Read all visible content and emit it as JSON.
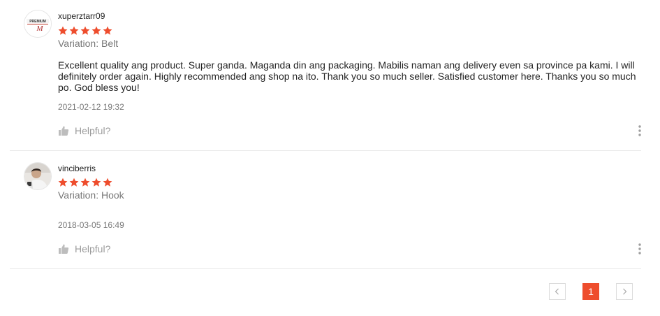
{
  "theme": {
    "accent": "#ee4d2d",
    "star_color": "#ee4d2d"
  },
  "reviews": [
    {
      "username": "xuperztarr09",
      "rating": 5,
      "variation": "Variation: Belt",
      "comment": "Excellent quality ang product. Super ganda. Maganda din ang packaging. Mabilis naman ang delivery even sa province pa kami. I will definitely order again. Highly recommended ang shop na ito. Thank you so much seller. Satisfied customer here. Thanks you so much po. God bless you!",
      "timestamp": "2021-02-12 19:32",
      "helpful_label": "Helpful?",
      "avatar_icon": "brand-logo-avatar"
    },
    {
      "username": "vinciberris",
      "rating": 5,
      "variation": "Variation: Hook",
      "comment": "",
      "timestamp": "2018-03-05 16:49",
      "helpful_label": "Helpful?",
      "avatar_icon": "person-photo-avatar"
    }
  ],
  "pagination": {
    "current_page": "1",
    "prev_icon": "chevron-left-icon",
    "next_icon": "chevron-right-icon"
  }
}
